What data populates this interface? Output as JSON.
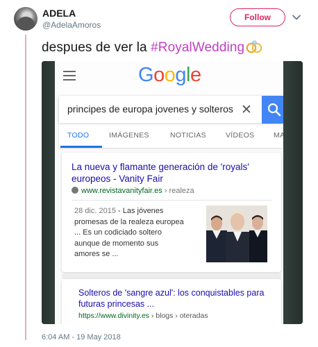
{
  "tweet": {
    "display_name": "ADELA",
    "handle": "@AdelaAmoros",
    "follow_label": "Follow",
    "text_prefix": "despues de ver la ",
    "hashtag": "#RoyalWedding",
    "timestamp": "6:04 AM - 19 May 2018"
  },
  "screenshot": {
    "logo": [
      "G",
      "o",
      "o",
      "g",
      "l",
      "e"
    ],
    "logo_colors": [
      "#4285F4",
      "#EA4335",
      "#FBBC05",
      "#4285F4",
      "#34A853",
      "#EA4335"
    ],
    "search_query": "principes de europa jovenes y solteros",
    "tabs": [
      "TODO",
      "IMÁGENES",
      "NOTICIAS",
      "VÍDEOS",
      "MA"
    ],
    "result1": {
      "title": "La nueva y flamante generación de 'royals' europeos - Vanity Fair",
      "url_domain": "www.revistavanityfair.es",
      "url_path": " › realeza",
      "date": "28 dic. 2015",
      "snippet": " - Las jóvenes promesas de la realeza europea ... Es un codiciado soltero aunque de momento sus amores se ..."
    },
    "result2": {
      "title": "Solteros de 'sangre azul': los conquistables para futuras princesas ...",
      "url_domain": "https://www.divinity.es",
      "url_path": " › blogs › oteradas"
    }
  },
  "colors": {
    "follow_accent": "#E0245E",
    "hashtag": "#C13FC4",
    "thread_line": "#E8A7C9",
    "link_blue": "#1A0DAB",
    "url_green": "#006621"
  }
}
